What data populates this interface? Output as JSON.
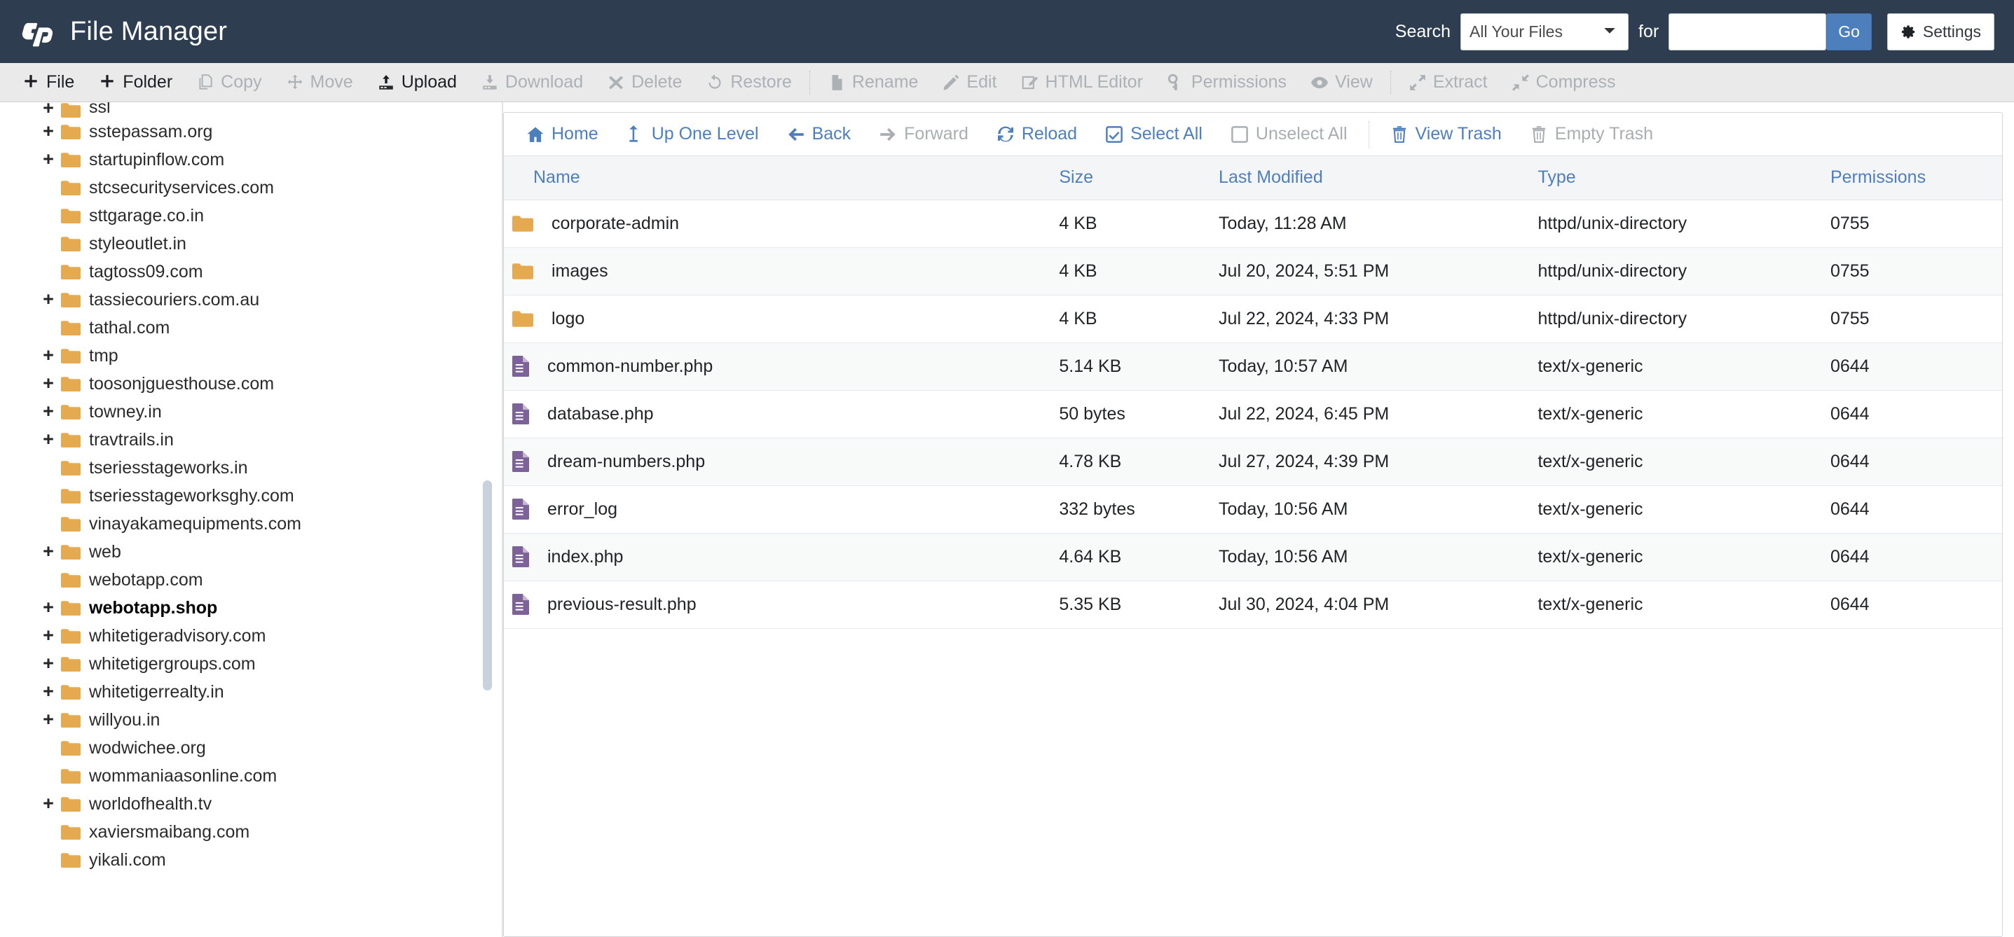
{
  "header": {
    "app_title": "File Manager",
    "logo_icon": "cpanel-logo",
    "search_label": "Search",
    "search_scope_selected": "All Your Files",
    "search_scope_options": [
      "All Your Files"
    ],
    "for_label": "for",
    "search_value": "",
    "search_placeholder": "",
    "go_label": "Go",
    "settings_label": "Settings",
    "settings_icon": "gear-icon",
    "accent_color": "#4e7fbd",
    "header_bg": "#2e3e50"
  },
  "toolbar": {
    "items": [
      {
        "label": "File",
        "icon": "plus-icon",
        "enabled": true
      },
      {
        "label": "Folder",
        "icon": "plus-icon",
        "enabled": true
      },
      {
        "label": "Copy",
        "icon": "copy-icon",
        "enabled": false
      },
      {
        "label": "Move",
        "icon": "move-icon",
        "enabled": false
      },
      {
        "label": "Upload",
        "icon": "upload-icon",
        "enabled": true
      },
      {
        "label": "Download",
        "icon": "download-icon",
        "enabled": false
      },
      {
        "label": "Delete",
        "icon": "delete-x-icon",
        "enabled": false
      },
      {
        "label": "Restore",
        "icon": "restore-icon",
        "enabled": false
      },
      {
        "label": "Rename",
        "icon": "rename-file-icon",
        "enabled": false
      },
      {
        "label": "Edit",
        "icon": "pencil-icon",
        "enabled": false
      },
      {
        "label": "HTML Editor",
        "icon": "html-editor-icon",
        "enabled": false
      },
      {
        "label": "Permissions",
        "icon": "key-icon",
        "enabled": false
      },
      {
        "label": "View",
        "icon": "eye-icon",
        "enabled": false
      },
      {
        "label": "Extract",
        "icon": "extract-icon",
        "enabled": false
      },
      {
        "label": "Compress",
        "icon": "compress-icon",
        "enabled": false
      }
    ],
    "separator_after": [
      7,
      12
    ]
  },
  "navbar": {
    "items": [
      {
        "label": "Home",
        "icon": "home-icon",
        "enabled": true
      },
      {
        "label": "Up One Level",
        "icon": "up-arrow-icon",
        "enabled": true
      },
      {
        "label": "Back",
        "icon": "arrow-left-icon",
        "enabled": true
      },
      {
        "label": "Forward",
        "icon": "arrow-right-icon",
        "enabled": false
      },
      {
        "label": "Reload",
        "icon": "reload-icon",
        "enabled": true
      },
      {
        "label": "Select All",
        "icon": "checkbox-checked-icon",
        "enabled": true
      },
      {
        "label": "Unselect All",
        "icon": "checkbox-empty-icon",
        "enabled": false
      },
      {
        "label": "View Trash",
        "icon": "trash-icon",
        "enabled": true
      },
      {
        "label": "Empty Trash",
        "icon": "trash-icon",
        "enabled": false
      }
    ],
    "separator_after": [
      6
    ]
  },
  "table": {
    "columns": [
      "Name",
      "Size",
      "Last Modified",
      "Type",
      "Permissions"
    ],
    "rows": [
      {
        "name": "corporate-admin",
        "size": "4 KB",
        "modified": "Today, 11:28 AM",
        "type": "httpd/unix-directory",
        "permissions": "0755",
        "kind": "folder"
      },
      {
        "name": "images",
        "size": "4 KB",
        "modified": "Jul 20, 2024, 5:51 PM",
        "type": "httpd/unix-directory",
        "permissions": "0755",
        "kind": "folder"
      },
      {
        "name": "logo",
        "size": "4 KB",
        "modified": "Jul 22, 2024, 4:33 PM",
        "type": "httpd/unix-directory",
        "permissions": "0755",
        "kind": "folder"
      },
      {
        "name": "common-number.php",
        "size": "5.14 KB",
        "modified": "Today, 10:57 AM",
        "type": "text/x-generic",
        "permissions": "0644",
        "kind": "file"
      },
      {
        "name": "database.php",
        "size": "50 bytes",
        "modified": "Jul 22, 2024, 6:45 PM",
        "type": "text/x-generic",
        "permissions": "0644",
        "kind": "file"
      },
      {
        "name": "dream-numbers.php",
        "size": "4.78 KB",
        "modified": "Jul 27, 2024, 4:39 PM",
        "type": "text/x-generic",
        "permissions": "0644",
        "kind": "file"
      },
      {
        "name": "error_log",
        "size": "332 bytes",
        "modified": "Today, 10:56 AM",
        "type": "text/x-generic",
        "permissions": "0644",
        "kind": "file"
      },
      {
        "name": "index.php",
        "size": "4.64 KB",
        "modified": "Today, 10:56 AM",
        "type": "text/x-generic",
        "permissions": "0644",
        "kind": "file"
      },
      {
        "name": "previous-result.php",
        "size": "5.35 KB",
        "modified": "Jul 30, 2024, 4:04 PM",
        "type": "text/x-generic",
        "permissions": "0644",
        "kind": "file"
      }
    ],
    "folder_icon_color": "#e5aa4f",
    "file_icon_color": "#7d6299"
  },
  "sidebar": {
    "items": [
      {
        "label": "ssl",
        "expandable": true,
        "active": false,
        "clipped": true
      },
      {
        "label": "sstepassam.org",
        "expandable": true,
        "active": false
      },
      {
        "label": "startupinflow.com",
        "expandable": true,
        "active": false
      },
      {
        "label": "stcsecurityservices.com",
        "expandable": false,
        "active": false
      },
      {
        "label": "sttgarage.co.in",
        "expandable": false,
        "active": false
      },
      {
        "label": "styleoutlet.in",
        "expandable": false,
        "active": false
      },
      {
        "label": "tagtoss09.com",
        "expandable": false,
        "active": false
      },
      {
        "label": "tassiecouriers.com.au",
        "expandable": true,
        "active": false
      },
      {
        "label": "tathal.com",
        "expandable": false,
        "active": false
      },
      {
        "label": "tmp",
        "expandable": true,
        "active": false
      },
      {
        "label": "toosonjguesthouse.com",
        "expandable": true,
        "active": false
      },
      {
        "label": "towney.in",
        "expandable": true,
        "active": false
      },
      {
        "label": "travtrails.in",
        "expandable": true,
        "active": false
      },
      {
        "label": "tseriesstageworks.in",
        "expandable": false,
        "active": false
      },
      {
        "label": "tseriesstageworksghy.com",
        "expandable": false,
        "active": false
      },
      {
        "label": "vinayakamequipments.com",
        "expandable": false,
        "active": false
      },
      {
        "label": "web",
        "expandable": true,
        "active": false
      },
      {
        "label": "webotapp.com",
        "expandable": false,
        "active": false
      },
      {
        "label": "webotapp.shop",
        "expandable": true,
        "active": true
      },
      {
        "label": "whitetigeradvisory.com",
        "expandable": true,
        "active": false
      },
      {
        "label": "whitetigergroups.com",
        "expandable": true,
        "active": false
      },
      {
        "label": "whitetigerrealty.in",
        "expandable": true,
        "active": false
      },
      {
        "label": "willyou.in",
        "expandable": true,
        "active": false
      },
      {
        "label": "wodwichee.org",
        "expandable": false,
        "active": false
      },
      {
        "label": "wommaniaasonline.com",
        "expandable": false,
        "active": false
      },
      {
        "label": "worldofhealth.tv",
        "expandable": true,
        "active": false
      },
      {
        "label": "xaviersmaibang.com",
        "expandable": false,
        "active": false
      },
      {
        "label": "yikali.com",
        "expandable": false,
        "active": false
      }
    ]
  }
}
